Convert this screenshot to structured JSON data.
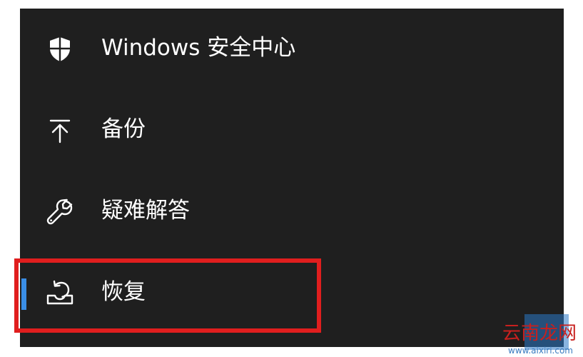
{
  "nav": {
    "items": [
      {
        "label": "Windows 安全中心",
        "icon": "shield-icon"
      },
      {
        "label": "备份",
        "icon": "backup-arrow-icon"
      },
      {
        "label": "疑难解答",
        "icon": "wrench-icon"
      },
      {
        "label": "恢复",
        "icon": "recovery-icon",
        "selected": true
      }
    ]
  },
  "watermark": {
    "site_name": "云南龙网",
    "url": "www.aixiri.com"
  },
  "colors": {
    "panel_bg": "#1f1f1f",
    "text": "#ffffff",
    "accent": "#3a8ee6",
    "highlight_border": "#e01e1e"
  }
}
